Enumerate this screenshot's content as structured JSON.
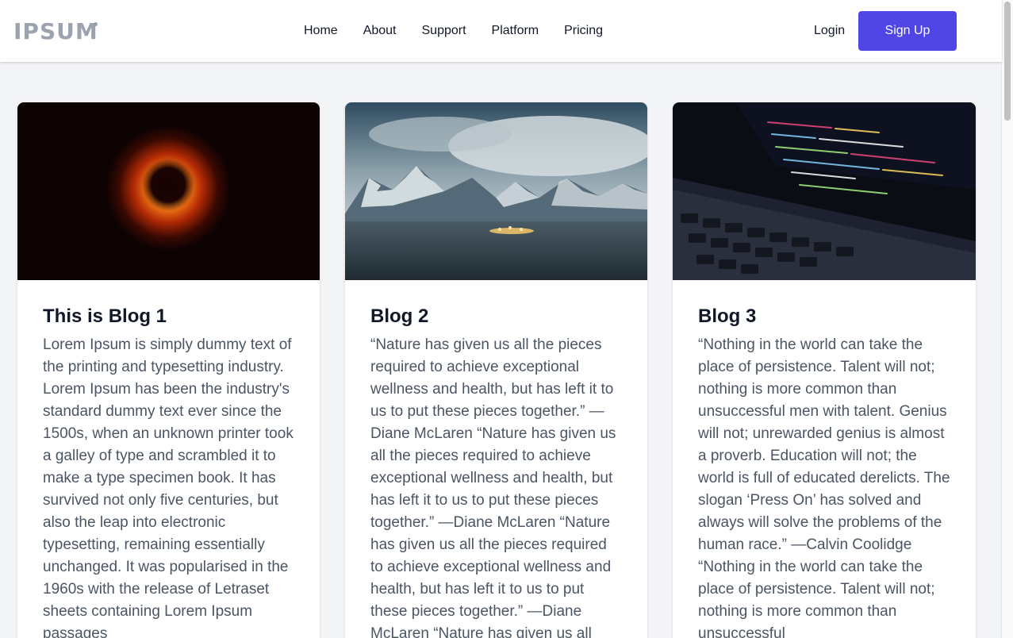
{
  "navbar": {
    "logo": "IPSUM",
    "links": [
      "Home",
      "About",
      "Support",
      "Platform",
      "Pricing"
    ],
    "login_label": "Login",
    "signup_label": "Sign Up"
  },
  "cards": [
    {
      "image": "black-hole-photo",
      "title": "This is Blog 1",
      "text": "Lorem Ipsum is simply dummy text of the printing and typesetting industry. Lorem Ipsum has been the industry's standard dummy text ever since the 1500s, when an unknown printer took a galley of type and scrambled it to make a type specimen book. It has survived not only five centuries, but also the leap into electronic typesetting, remaining essentially unchanged. It was popularised in the 1960s with the release of Letraset sheets containing Lorem Ipsum passages"
    },
    {
      "image": "mountain-landscape-photo",
      "title": "Blog 2",
      "text": "“Nature has given us all the pieces required to achieve exceptional wellness and health, but has left it to us to put these pieces together.” —Diane McLaren “Nature has given us all the pieces required to achieve exceptional wellness and health, but has left it to us to put these pieces together.” —Diane McLaren “Nature has given us all the pieces required to achieve exceptional wellness and health, but has left it to us to put these pieces together.” —Diane McLaren “Nature has given us all"
    },
    {
      "image": "laptop-code-photo",
      "title": "Blog 3",
      "text": "“Nothing in the world can take the place of persistence. Talent will not; nothing is more common than unsuccessful men with talent. Genius will not; unrewarded genius is almost a proverb. Education will not; the world is full of educated derelicts. The slogan ‘Press On’ has solved and always will solve the problems of the human race.” —Calvin Coolidge “Nothing in the world can take the place of persistence. Talent will not; nothing is more common than unsuccessful"
    }
  ],
  "colors": {
    "accent": "#4f46e5",
    "logo": "#9ca3af",
    "page_background": "#f3f4f6",
    "body_text": "#4b5563"
  }
}
